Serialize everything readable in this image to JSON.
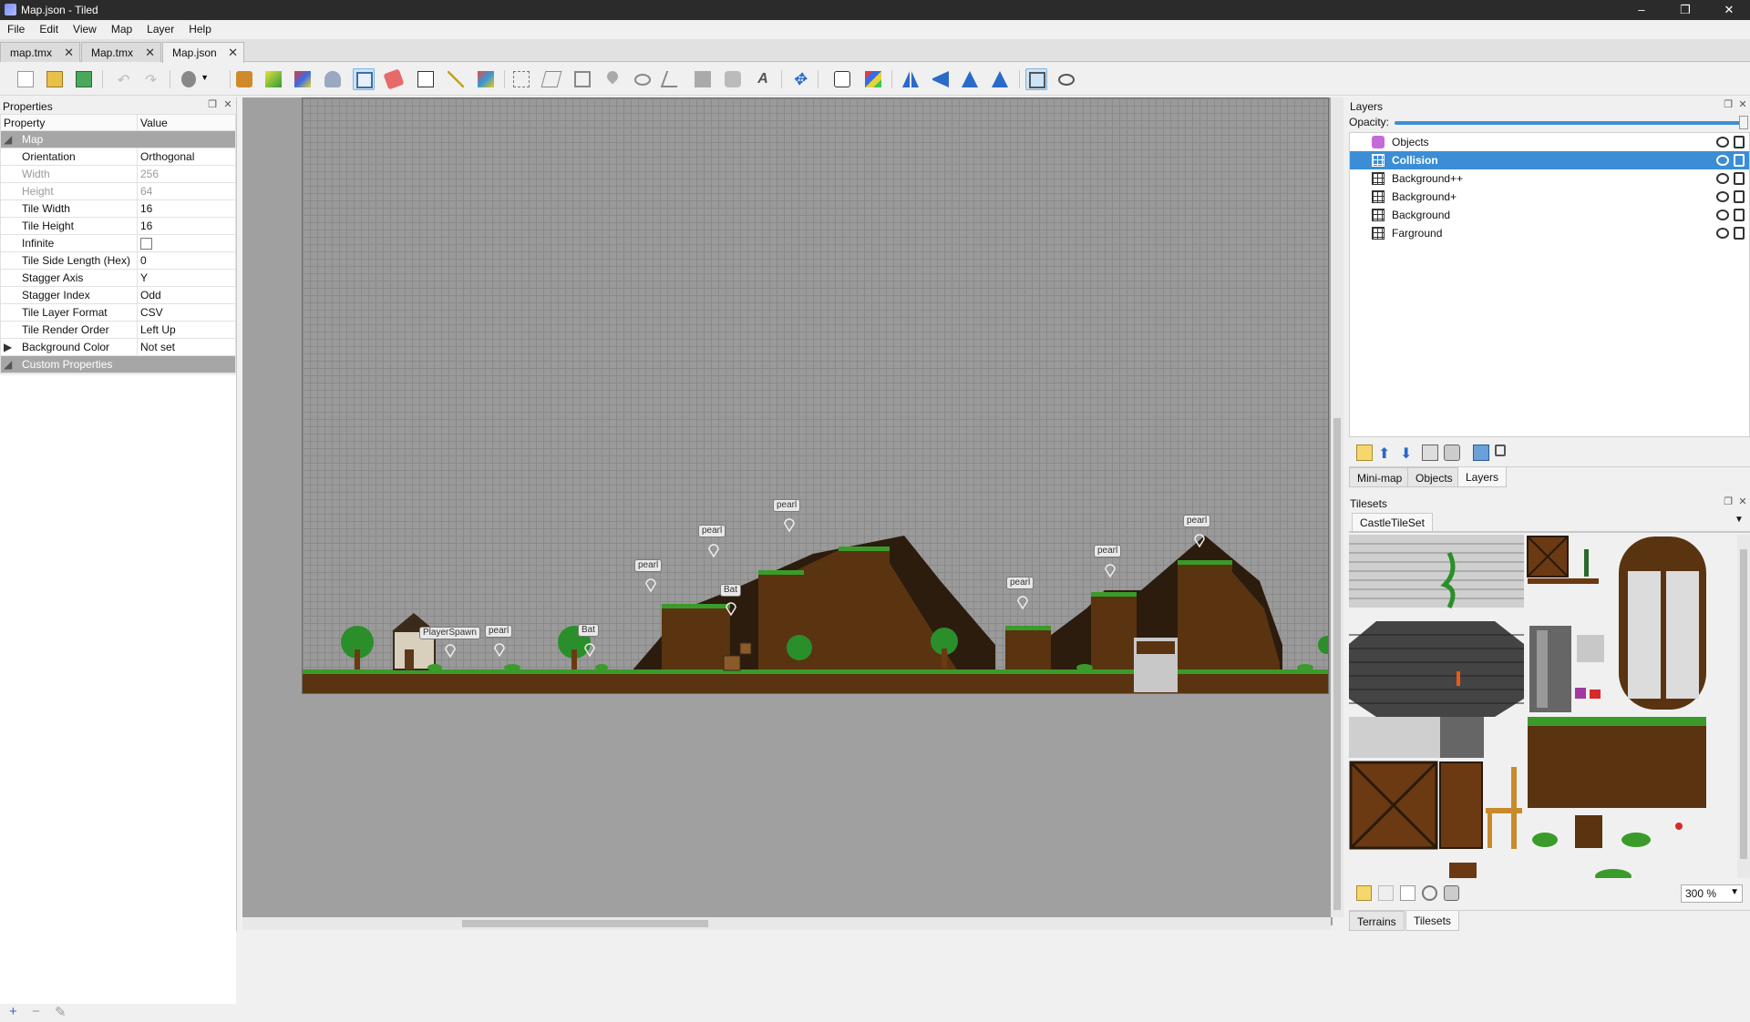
{
  "window": {
    "title": "Map.json - Tiled",
    "buttons": {
      "minimize": "–",
      "maximize": "❐",
      "close": "✕"
    }
  },
  "menu": [
    "File",
    "Edit",
    "View",
    "Map",
    "Layer",
    "Help"
  ],
  "doc_tabs": [
    {
      "label": "map.tmx",
      "active": false
    },
    {
      "label": "Map.tmx",
      "active": false
    },
    {
      "label": "Map.json",
      "active": true
    }
  ],
  "toolbar": {
    "icons": [
      "new-document-icon",
      "open-icon",
      "save-icon",
      "undo-icon",
      "redo-icon",
      "command-icon",
      "random-mode-icon",
      "wang-fill-icon",
      "terrain-brush-icon",
      "bucket-fill-icon",
      "stamp-brush-icon",
      "eraser-icon",
      "rectangle-select-icon",
      "magic-wand-icon",
      "select-same-tile-icon",
      "select-objects-icon",
      "edit-polygons-icon",
      "insert-rectangle-icon",
      "insert-point-icon",
      "insert-ellipse-icon",
      "insert-polygon-icon",
      "insert-tile-icon",
      "insert-template-icon",
      "insert-text-icon",
      "move-icon",
      "random-dice-icon",
      "wang-colors-icon",
      "flip-horizontal-icon",
      "flip-vertical-icon",
      "rotate-left-icon",
      "rotate-right-icon",
      "highlight-layer-icon",
      "ellipse-tool-icon"
    ]
  },
  "properties_panel": {
    "title": "Properties",
    "headers": {
      "property": "Property",
      "value": "Value"
    },
    "groups": {
      "map": "Map",
      "custom": "Custom Properties"
    },
    "rows": [
      {
        "name": "Orientation",
        "value": "Orthogonal",
        "disabled": false
      },
      {
        "name": "Width",
        "value": "256",
        "disabled": true
      },
      {
        "name": "Height",
        "value": "64",
        "disabled": true
      },
      {
        "name": "Tile Width",
        "value": "16",
        "disabled": false
      },
      {
        "name": "Tile Height",
        "value": "16",
        "disabled": false
      },
      {
        "name": "Infinite",
        "value": "",
        "checkbox": true,
        "disabled": false
      },
      {
        "name": "Tile Side Length (Hex)",
        "value": "0",
        "disabled": false
      },
      {
        "name": "Stagger Axis",
        "value": "Y",
        "disabled": false
      },
      {
        "name": "Stagger Index",
        "value": "Odd",
        "disabled": false
      },
      {
        "name": "Tile Layer Format",
        "value": "CSV",
        "disabled": false
      },
      {
        "name": "Tile Render Order",
        "value": "Left Up",
        "disabled": false
      },
      {
        "name": "Background Color",
        "value": "Not set",
        "expandable": true,
        "disabled": false
      }
    ]
  },
  "map_objects": [
    {
      "label": "PlayerSpawn"
    },
    {
      "label": "pearl"
    },
    {
      "label": "Bat"
    },
    {
      "label": "pearl"
    },
    {
      "label": "pearl"
    },
    {
      "label": "Bat"
    },
    {
      "label": "pearl"
    },
    {
      "label": "pearl"
    },
    {
      "label": "pearl"
    },
    {
      "label": "pearl"
    }
  ],
  "layers_panel": {
    "title": "Layers",
    "opacity_label": "Opacity:",
    "opacity": 1.0,
    "layers": [
      {
        "name": "Objects",
        "type": "object",
        "selected": false
      },
      {
        "name": "Collision",
        "type": "tile",
        "selected": true
      },
      {
        "name": "Background++",
        "type": "tile",
        "selected": false
      },
      {
        "name": "Background+",
        "type": "tile",
        "selected": false
      },
      {
        "name": "Background",
        "type": "tile",
        "selected": false
      },
      {
        "name": "Farground",
        "type": "tile",
        "selected": false
      }
    ],
    "tabs": [
      {
        "label": "Mini-map",
        "active": false
      },
      {
        "label": "Objects",
        "active": false
      },
      {
        "label": "Layers",
        "active": true
      }
    ]
  },
  "tilesets_panel": {
    "title": "Tilesets",
    "tileset_tab": "CastleTileSet",
    "zoom": "300 %",
    "tabs": [
      {
        "label": "Terrains",
        "active": false
      },
      {
        "label": "Tilesets",
        "active": true
      }
    ]
  },
  "colors": {
    "selection": "#3b8ed6",
    "grass": "#3a9b2a",
    "dirt": "#5a3310",
    "cave": "#2b1c0e"
  }
}
